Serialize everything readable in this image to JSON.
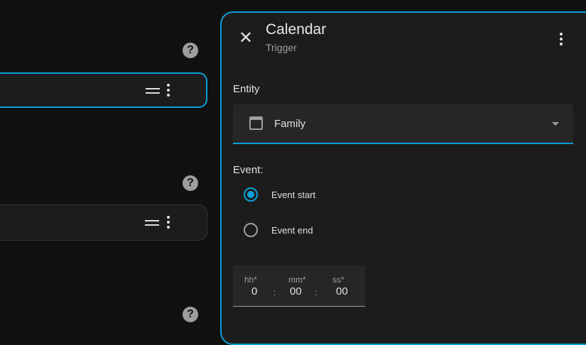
{
  "panel": {
    "title": "Calendar",
    "subtitle": "Trigger"
  },
  "entity": {
    "label": "Entity",
    "value": "Family"
  },
  "event": {
    "label": "Event:",
    "options": [
      {
        "label": "Event start",
        "selected": true
      },
      {
        "label": "Event end",
        "selected": false
      }
    ]
  },
  "offset": {
    "hh_label": "hh*",
    "hh": "0",
    "mm_label": "mm*",
    "mm": "00",
    "ss_label": "ss*",
    "ss": "00",
    "sep": ":"
  },
  "help": "?",
  "colors": {
    "accent": "#0aa0d8",
    "background": "#111111",
    "panel": "#1c1c1c"
  }
}
